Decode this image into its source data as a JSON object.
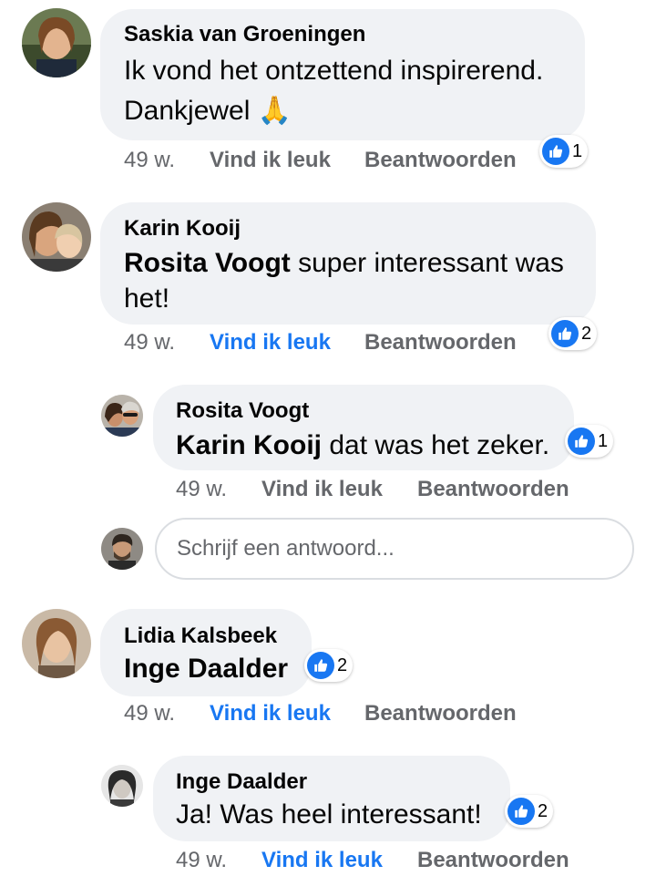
{
  "comments": [
    {
      "author": "Saskia van Groeningen",
      "text_line1": "Ik vond het ontzettend inspirerend.",
      "text_line2": "Dankjewel",
      "emoji": "🙏",
      "time": "49 w.",
      "like_label": "Vind ik leuk",
      "reply_label": "Beantwoorden",
      "reactions": "1",
      "liked_by_viewer": false
    },
    {
      "author": "Karin Kooij",
      "mention": "Rosita Voogt",
      "text_rest": " super interessant was",
      "text_line2": "het!",
      "time": "49 w.",
      "like_label": "Vind ik leuk",
      "reply_label": "Beantwoorden",
      "reactions": "2",
      "liked_by_viewer": true,
      "replies": [
        {
          "author": "Rosita Voogt",
          "mention": "Karin Kooij",
          "text_rest": " dat was het zeker.",
          "time": "49 w.",
          "like_label": "Vind ik leuk",
          "reply_label": "Beantwoorden",
          "reactions": "1",
          "liked_by_viewer": false
        }
      ]
    },
    {
      "author": "Lidia Kalsbeek",
      "mention": "Inge Daalder",
      "time": "49 w.",
      "like_label": "Vind ik leuk",
      "reply_label": "Beantwoorden",
      "reactions": "2",
      "liked_by_viewer": true,
      "replies": [
        {
          "author": "Inge Daalder",
          "text": "Ja! Was heel interessant!",
          "time": "49 w.",
          "like_label": "Vind ik leuk",
          "reply_label": "Beantwoorden",
          "reactions": "2",
          "liked_by_viewer": true
        }
      ]
    }
  ],
  "reply_box": {
    "placeholder": "Schrijf een antwoord..."
  },
  "colors": {
    "bubble": "#f0f2f5",
    "link_blue": "#1877f2",
    "secondary_text": "#65676b"
  },
  "icons": {
    "reaction": "thumbs-up-icon",
    "emoji": "folded-hands-emoji"
  }
}
